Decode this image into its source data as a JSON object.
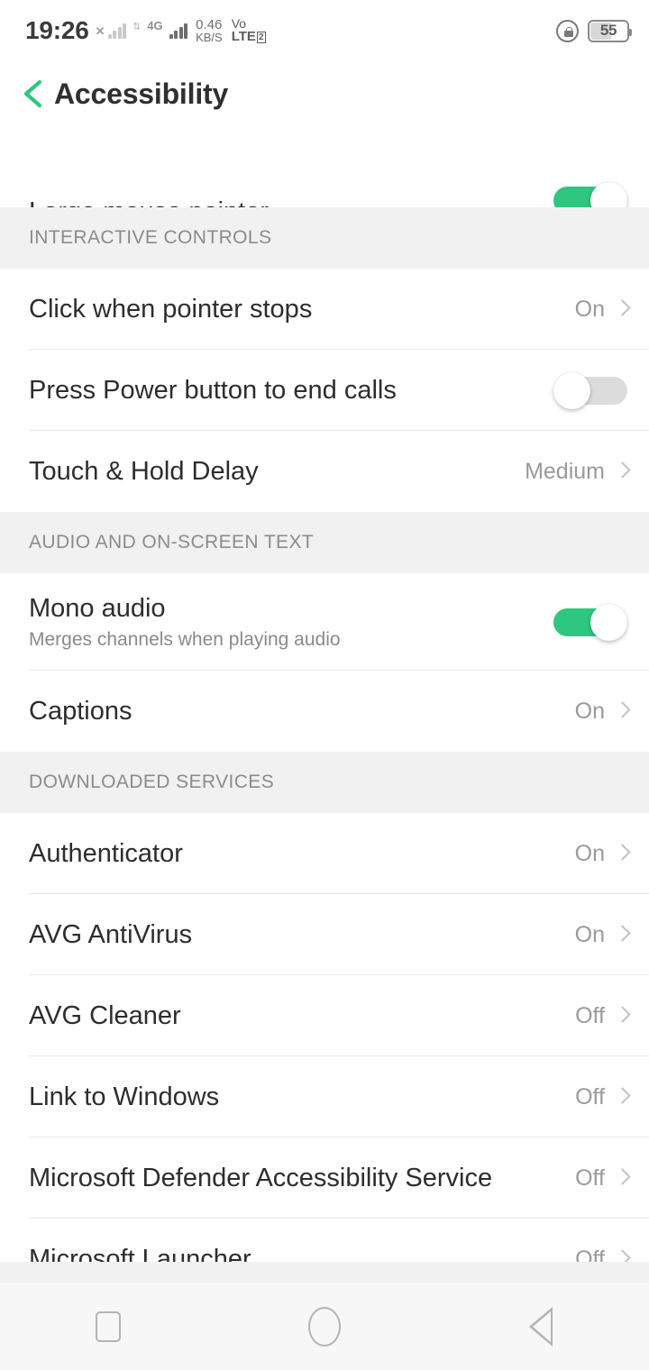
{
  "status_bar": {
    "time": "19:26",
    "mute_icon": "x-mute-icon",
    "network_type": "4G",
    "data_rate_value": "0.46",
    "data_rate_unit": "KB/S",
    "volte_line1": "Vo",
    "volte_line2": "LTE",
    "volte_sim": "2",
    "rotation_lock_icon": "rotation-lock-icon",
    "battery_percent": "55"
  },
  "header": {
    "back_icon": "back-chevron-icon",
    "title": "Accessibility",
    "accent_color": "#2ec77f"
  },
  "list": [
    {
      "type": "row",
      "partial": true,
      "title": "Large mouse pointer",
      "control": "toggle",
      "toggle_on": true,
      "divider": false
    },
    {
      "type": "section",
      "label": "INTERACTIVE CONTROLS"
    },
    {
      "type": "row",
      "title": "Click when pointer stops",
      "control": "value",
      "value": "On",
      "divider": true
    },
    {
      "type": "row",
      "title": "Press Power button to end calls",
      "control": "toggle",
      "toggle_on": false,
      "divider": true
    },
    {
      "type": "row",
      "title": "Touch & Hold Delay",
      "control": "value",
      "value": "Medium",
      "divider": false
    },
    {
      "type": "section",
      "label": "AUDIO AND ON-SCREEN TEXT"
    },
    {
      "type": "row",
      "title": "Mono audio",
      "subtitle": "Merges channels when playing audio",
      "control": "toggle",
      "toggle_on": true,
      "divider": true
    },
    {
      "type": "row",
      "title": "Captions",
      "control": "value",
      "value": "On",
      "divider": false
    },
    {
      "type": "section",
      "label": "DOWNLOADED SERVICES"
    },
    {
      "type": "row",
      "title": "Authenticator",
      "control": "value",
      "value": "On",
      "divider": true
    },
    {
      "type": "row",
      "title": "AVG AntiVirus",
      "control": "value",
      "value": "On",
      "divider": true
    },
    {
      "type": "row",
      "title": "AVG Cleaner",
      "control": "value",
      "value": "Off",
      "divider": true
    },
    {
      "type": "row",
      "title": "Link to Windows",
      "control": "value",
      "value": "Off",
      "divider": true
    },
    {
      "type": "row",
      "title": "Microsoft Defender Accessibility Service",
      "control": "value",
      "value": "Off",
      "divider": true
    },
    {
      "type": "row",
      "title": "Microsoft Launcher",
      "control": "value",
      "value": "Off",
      "divider": false
    }
  ],
  "navbar": {
    "recents_icon": "recents-square-icon",
    "home_icon": "home-circle-icon",
    "back_icon": "back-triangle-icon"
  }
}
